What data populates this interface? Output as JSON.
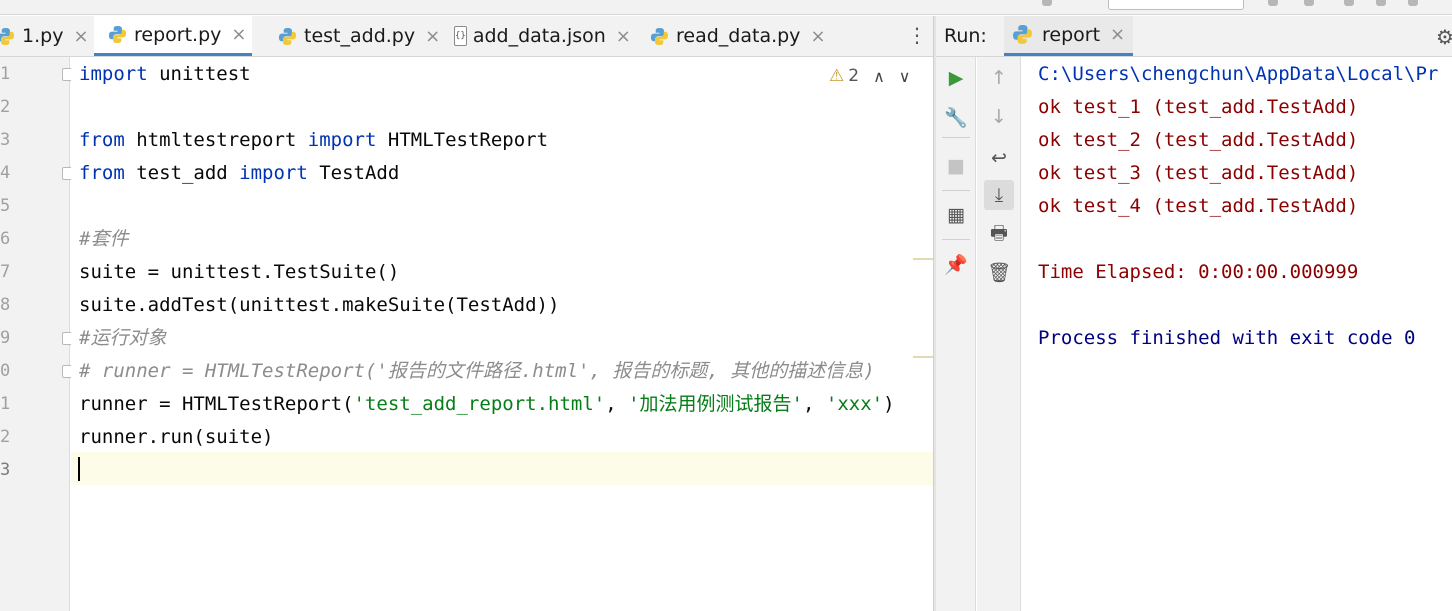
{
  "colors": {
    "keyword": "#0033b3",
    "string": "#067d17",
    "comment": "#8c8c8c",
    "plain": "#080808",
    "console_path": "#0033b3",
    "console_error_red": "#8b0000",
    "console_exit": "#000080",
    "active_tab_underline": "#4083c9",
    "current_line_bg": "#fdfce9"
  },
  "editor_tabs": [
    {
      "label": "1.py",
      "icon": "python-file-icon",
      "active": false
    },
    {
      "label": "report.py",
      "icon": "python-file-icon",
      "active": true
    },
    {
      "label": "test_add.py",
      "icon": "python-file-icon",
      "active": false
    },
    {
      "label": "add_data.json",
      "icon": "json-file-icon",
      "json_glyph": "{}",
      "active": false
    },
    {
      "label": "read_data.py",
      "icon": "python-file-icon",
      "active": false
    }
  ],
  "tab_close_glyph": "×",
  "editor": {
    "line_numbers": [
      "1",
      "2",
      "3",
      "4",
      "5",
      "6",
      "7",
      "8",
      "9",
      "0",
      "1",
      "2",
      "3"
    ],
    "inspection": {
      "warning_glyph": "⚠",
      "count": "2",
      "up": "∧",
      "down": "∨"
    },
    "lines": [
      [
        {
          "t": "import",
          "k": "kw"
        },
        {
          "t": " unittest",
          "k": "plain"
        }
      ],
      [],
      [
        {
          "t": "from",
          "k": "kw"
        },
        {
          "t": " htmltestreport ",
          "k": "plain"
        },
        {
          "t": "import",
          "k": "kw"
        },
        {
          "t": " HTMLTestReport",
          "k": "plain"
        }
      ],
      [
        {
          "t": "from",
          "k": "kw"
        },
        {
          "t": " test_add ",
          "k": "plain"
        },
        {
          "t": "import",
          "k": "kw"
        },
        {
          "t": " TestAdd",
          "k": "plain"
        }
      ],
      [],
      [
        {
          "t": "#套件",
          "k": "com"
        }
      ],
      [
        {
          "t": "suite = unittest.TestSuite()",
          "k": "plain"
        }
      ],
      [
        {
          "t": "suite.addTest(unittest.makeSuite(TestAdd))",
          "k": "plain"
        }
      ],
      [
        {
          "t": "#运行对象",
          "k": "com"
        }
      ],
      [
        {
          "t": "# runner = HTMLTestReport('报告的文件路径.html', 报告的标题, 其他的描述信息)",
          "k": "com"
        }
      ],
      [
        {
          "t": "runner = HTMLTestReport(",
          "k": "plain"
        },
        {
          "t": "'test_add_report.html'",
          "k": "str"
        },
        {
          "t": ", ",
          "k": "plain"
        },
        {
          "t": "'加法用例测试报告'",
          "k": "str"
        },
        {
          "t": ", ",
          "k": "plain"
        },
        {
          "t": "'xxx'",
          "k": "str"
        },
        {
          "t": ")",
          "k": "plain"
        }
      ],
      [
        {
          "t": "runner.run(suite)",
          "k": "plain"
        }
      ],
      []
    ]
  },
  "run_panel": {
    "label": "Run:",
    "tab": {
      "label": "report",
      "icon": "python-file-icon"
    },
    "console": [
      {
        "text": "C:\\Users\\chengchun\\AppData\\Local\\Pr",
        "kind": "path"
      },
      {
        "text": "ok test_1 (test_add.TestAdd)",
        "kind": "err"
      },
      {
        "text": "ok test_2 (test_add.TestAdd)",
        "kind": "err"
      },
      {
        "text": "ok test_3 (test_add.TestAdd)",
        "kind": "err"
      },
      {
        "text": "ok test_4 (test_add.TestAdd)",
        "kind": "err"
      },
      {
        "text": "",
        "kind": "err"
      },
      {
        "text": "Time Elapsed: 0:00:00.000999",
        "kind": "err"
      },
      {
        "text": "",
        "kind": "err"
      },
      {
        "text": "Process finished with exit code 0",
        "kind": "exit"
      }
    ],
    "toolbar_left": [
      {
        "name": "rerun-icon",
        "glyph": "▶",
        "color": "#3a9a3a"
      },
      {
        "name": "wrench-icon",
        "glyph": "🔧",
        "color": "#555555"
      },
      {
        "name": "stop-icon",
        "glyph": "■",
        "color": "#c4c4c4"
      },
      {
        "name": "layout-icon",
        "glyph": "▦",
        "color": "#555555"
      },
      {
        "name": "pin-icon",
        "glyph": "📌",
        "color": "#555555"
      }
    ],
    "toolbar_right": [
      {
        "name": "up-arrow-icon",
        "glyph": "↑",
        "color": "#a8a8a8"
      },
      {
        "name": "down-arrow-icon",
        "glyph": "↓",
        "color": "#a8a8a8"
      },
      {
        "name": "soft-wrap-icon",
        "glyph": "↩",
        "color": "#555555"
      },
      {
        "name": "scroll-to-end-icon",
        "glyph": "⤓",
        "color": "#555555"
      },
      {
        "name": "print-icon",
        "glyph": "🖶",
        "color": "#555555"
      },
      {
        "name": "trash-icon",
        "glyph": "🗑",
        "color": "#555555"
      }
    ]
  }
}
